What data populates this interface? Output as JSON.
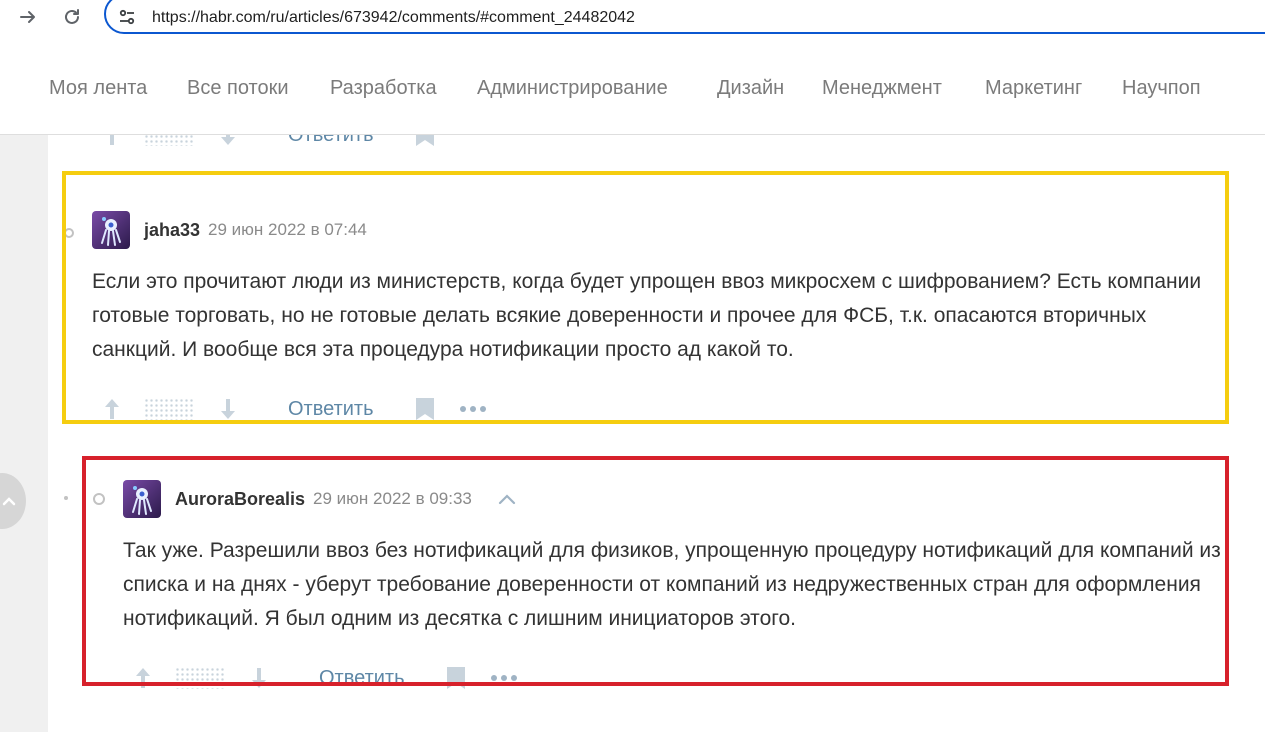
{
  "browser": {
    "url": "https://habr.com/ru/articles/673942/comments/#comment_24482042",
    "icons": [
      "forward-icon",
      "reload-icon",
      "site-settings-icon"
    ]
  },
  "nav": {
    "items": [
      "Моя лента",
      "Все потоки",
      "Разработка",
      "Администрирование",
      "Дизайн",
      "Менеджмент",
      "Маркетинг",
      "Научпоп"
    ]
  },
  "actions_label": {
    "reply": "Ответить"
  },
  "comments": [
    {
      "username": "jaha33",
      "timestamp": "29 июн 2022 в 07:44",
      "text": "Если это прочитают люди из министерств, когда будет упрощен ввоз микросхем с шифрованием? Есть компании готовые торговать, но не готовые делать всякие доверенности и прочее для ФСБ, т.к. опасаются вторичных санкций. И вообще вся эта процедура нотификации просто ад какой то."
    },
    {
      "username": "AuroraBorealis",
      "timestamp": "29 июн 2022 в 09:33",
      "text": "Так уже. Разрешили ввоз без нотификаций для физиков, упрощенную процедуру нотификаций для компаний из списка и на днях - уберут требование доверенности от компаний из недружественных стран для оформления нотификаций. Я был одним из десятка с лишним инициаторов этого."
    }
  ],
  "colors": {
    "highlight_yellow": "#f5cd0f",
    "highlight_red": "#d7212b",
    "link": "#5e87a6",
    "address_border": "#0b57d0"
  }
}
